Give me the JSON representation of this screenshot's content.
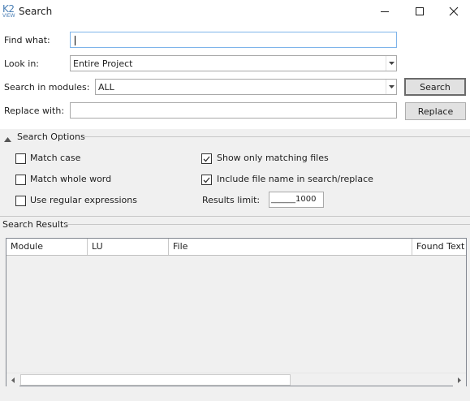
{
  "window": {
    "logo_top": "K2",
    "logo_bottom": "VIEW",
    "title": "Search"
  },
  "form": {
    "find_label": "Find what:",
    "find_value": "",
    "lookin_label": "Look in:",
    "lookin_value": "Entire Project",
    "modules_label": "Search in modules:",
    "modules_value": "ALL",
    "replace_label": "Replace with:",
    "replace_value": "",
    "search_button": "Search",
    "replace_button": "Replace"
  },
  "options": {
    "header": "Search Options",
    "match_case": {
      "label": "Match case",
      "checked": false
    },
    "match_whole_word": {
      "label": "Match whole word",
      "checked": false
    },
    "use_regex": {
      "label": "Use regular expressions",
      "checked": false
    },
    "show_only_matching": {
      "label": "Show only matching files",
      "checked": true
    },
    "include_file_name": {
      "label": "Include file name in search/replace",
      "checked": true
    },
    "results_limit_label": "Results limit:",
    "results_limit_value": "______1000"
  },
  "results": {
    "header": "Search Results",
    "columns": [
      "Module",
      "LU",
      "File",
      "Found Text"
    ],
    "rows": []
  }
}
